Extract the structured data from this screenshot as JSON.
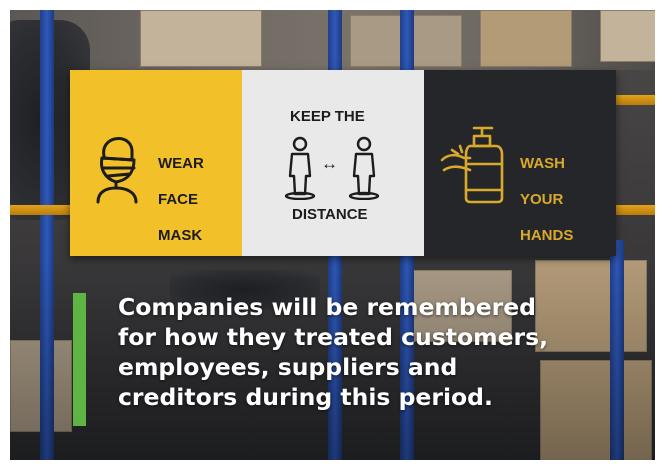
{
  "sign": {
    "panel_mask": {
      "line1": "WEAR",
      "line2": "FACE",
      "line3": "MASK"
    },
    "panel_distance": {
      "top": "KEEP THE",
      "bottom": "DISTANCE",
      "arrow": "↔"
    },
    "panel_wash": {
      "line1": "WASH",
      "line2": "YOUR",
      "line3": "HANDS"
    }
  },
  "quote": {
    "line1": "Companies will be remembered",
    "line2": "for how they treated customers,",
    "line3": "employees, suppliers and",
    "line4": "creditors during this period."
  },
  "colors": {
    "sign_yellow": "#f2c12a",
    "sign_white": "#e9e9ea",
    "sign_black": "#25262a",
    "wash_text": "#d9a92c",
    "accent_green": "#5fb544",
    "quote_text": "#ffffff"
  }
}
